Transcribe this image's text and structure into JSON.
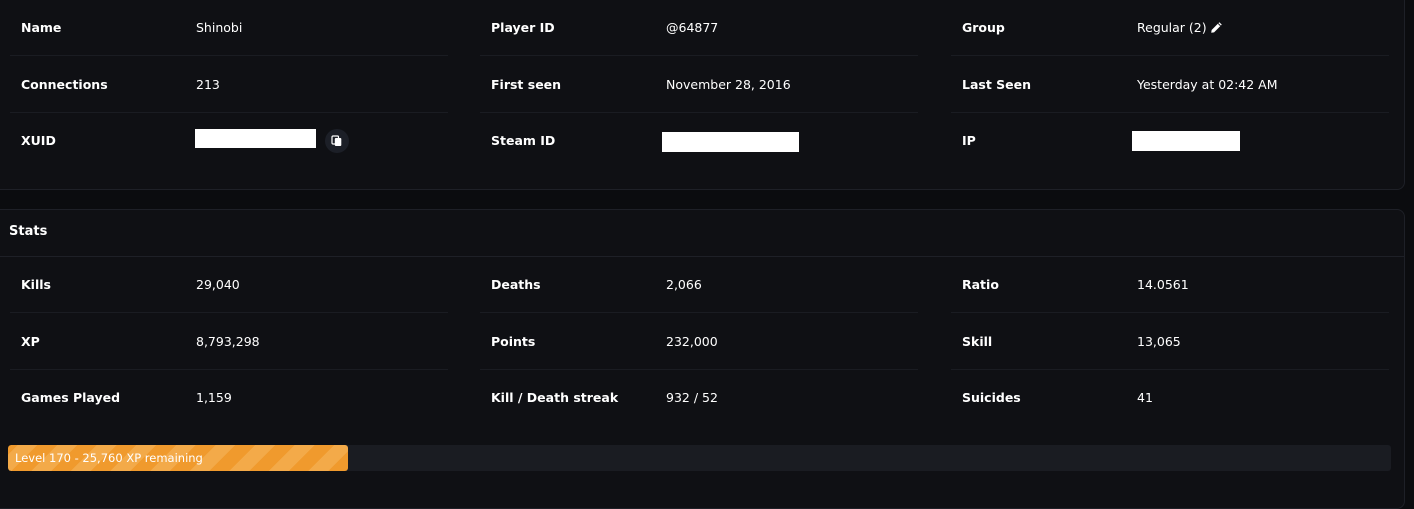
{
  "player_info": {
    "rows": [
      [
        {
          "label": "Name",
          "value": "Shinobi"
        },
        {
          "label": "Player ID",
          "value": "@64877"
        },
        {
          "label": "Group",
          "value": "Regular (2)"
        }
      ],
      [
        {
          "label": "Connections",
          "value": "213"
        },
        {
          "label": "First seen",
          "value": "November 28, 2016"
        },
        {
          "label": "Last Seen",
          "value": "Yesterday at 02:42 AM"
        }
      ],
      [
        {
          "label": "XUID",
          "value": ""
        },
        {
          "label": "Steam ID",
          "value": ""
        },
        {
          "label": "IP",
          "value": ""
        }
      ]
    ],
    "icons": {
      "copy": "copy-icon",
      "edit": "pencil-icon"
    }
  },
  "stats": {
    "title": "Stats",
    "rows": [
      [
        {
          "label": "Kills",
          "value": "29,040"
        },
        {
          "label": "Deaths",
          "value": "2,066"
        },
        {
          "label": "Ratio",
          "value": "14.0561"
        }
      ],
      [
        {
          "label": "XP",
          "value": "8,793,298"
        },
        {
          "label": "Points",
          "value": "232,000"
        },
        {
          "label": "Skill",
          "value": "13,065"
        }
      ],
      [
        {
          "label": "Games Played",
          "value": "1,159"
        },
        {
          "label": "Kill / Death streak",
          "value": "932 / 52"
        },
        {
          "label": "Suicides",
          "value": "41"
        }
      ]
    ]
  },
  "level_progress": {
    "label": "Level 170 - 25,760 XP remaining",
    "fraction": 0.246
  },
  "colors": {
    "background": "#0b0c0f",
    "card": "#0f1014",
    "accent": "#f09a2d"
  }
}
